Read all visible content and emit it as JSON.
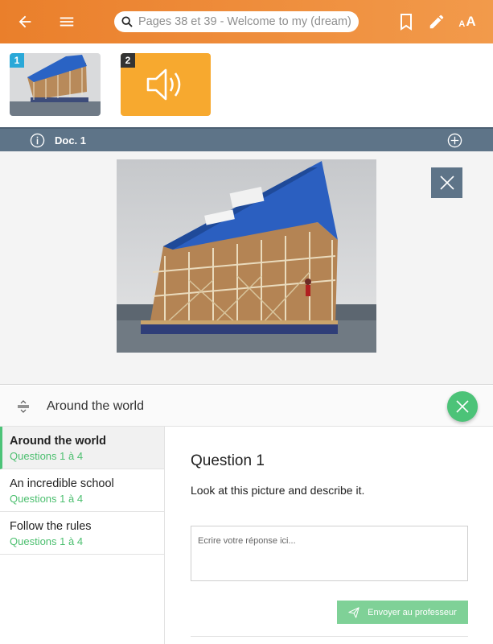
{
  "topbar": {
    "back_icon": "arrow-left-icon",
    "menu_icon": "hamburger-menu-icon",
    "search_icon": "magnifier-icon",
    "search_placeholder": "Pages 38 et 39 - Welcome to my (dream)",
    "bookmark_icon": "bookmark-icon",
    "edit_icon": "pencil-icon",
    "font_size_small": "A",
    "font_size_large": "A",
    "color_start": "#ea7f2b",
    "color_end": "#f29a4b"
  },
  "thumbnails": [
    {
      "number": "1",
      "kind": "photo",
      "badge_color": "#2aa8d8"
    },
    {
      "number": "2",
      "kind": "audio",
      "badge_color": "#333333",
      "icon": "speaker-icon",
      "color": "#f7a92f"
    }
  ],
  "docbar": {
    "info_icon": "info-icon",
    "label": "Doc. 1",
    "zoom_icon": "plus-circle-icon",
    "color": "#5e7488"
  },
  "viewer": {
    "close_icon": "close-icon"
  },
  "activity": {
    "toggle_icon": "expand-collapse-icon",
    "title": "Around the world",
    "close_icon": "close-icon",
    "accent": "#4cc378"
  },
  "sections": [
    {
      "title": "Around the world",
      "subtitle": "Questions 1 à 4",
      "active": true
    },
    {
      "title": "An incredible school",
      "subtitle": "Questions 1 à 4",
      "active": false
    },
    {
      "title": "Follow the rules",
      "subtitle": "Questions 1 à 4",
      "active": false
    }
  ],
  "question": {
    "title": "Question 1",
    "text": "Look at this picture and describe it.",
    "answer_placeholder": "Ecrire votre réponse ici...",
    "send_label": "Envoyer au professeur",
    "send_icon": "paper-plane-icon"
  }
}
